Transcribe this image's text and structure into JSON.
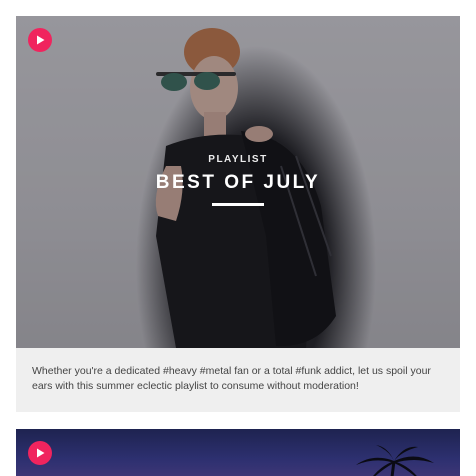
{
  "cards": [
    {
      "kicker": "PLAYLIST",
      "title": "BEST OF JULY",
      "description": "Whether you're a dedicated #heavy #metal fan or a total #funk addict, let us spoil your ears with this summer eclectic playlist to consume without moderation!"
    },
    {
      "kicker": "",
      "title": "",
      "description": ""
    }
  ],
  "colors": {
    "accent": "#f0245e",
    "description_bg": "#efefef",
    "description_text": "#444444"
  },
  "icons": {
    "play": "play-icon"
  }
}
